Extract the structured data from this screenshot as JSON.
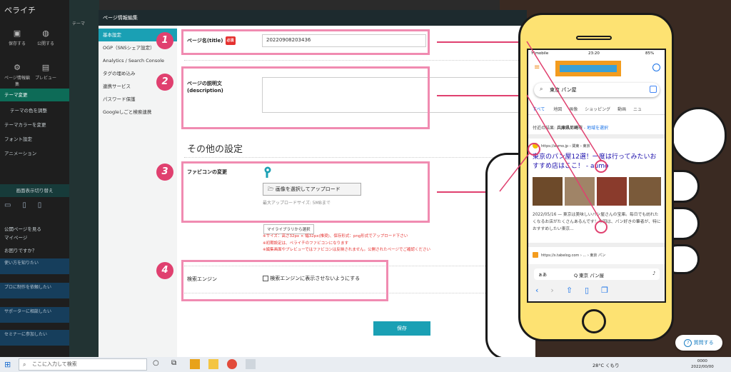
{
  "app": {
    "logo": "ペライチ",
    "toolbar": [
      {
        "label": "保存する",
        "icon": "save-icon"
      },
      {
        "label": "公開する",
        "icon": "publish-icon"
      }
    ],
    "toolbar2": [
      {
        "label": "ページ情報編集",
        "icon": "gear-icon"
      },
      {
        "label": "プレビュー",
        "icon": "preview-icon"
      }
    ],
    "menu": [
      "テーマ変更",
      "テーマの色を調整",
      "テーマカラーを変更",
      "フォント設定",
      "アニメーション"
    ],
    "device_label": "画面表示切り替え",
    "side_links": [
      "公開ページを見る",
      "マイページ",
      "お困りですか？"
    ],
    "promos": [
      "使い方を知りたい",
      "プロに制作を依頼したい",
      "サポーターに相談したい",
      "セミナーに参加したい"
    ],
    "theme_tab": "テーマ"
  },
  "modal": {
    "title": "ページ情報編集",
    "nav": [
      "基本設定",
      "OGP（SNSシェア設定）",
      "Analytics / Search Console",
      "タグの埋め込み",
      "連携サービス",
      "パスワード保護",
      "Googleしごと検索連携"
    ],
    "page_name_label": "ページ名(title)",
    "required_badge": "必須",
    "page_name_value": "20220908203436",
    "description_label": "ページの説明文\n(description)",
    "description_value": "",
    "other_heading": "その他の設定",
    "favicon_label": "ファビコンの変更",
    "upload_button": "画像を選択してアップロード",
    "upload_note": "最大アップロードサイズ: 5MBまで",
    "library_button": "マイライブラリから選択",
    "notes": [
      "※サイズ：高さ32px × 幅32px(推奨)、保存形式：png形式でアップロード下さい",
      "※初期設定は、ペライチのファビコンになります",
      "※編集画面やプレビューではファビコンは反映されません。公開されたページでご確認ください"
    ],
    "search_engine_label": "検索エンジン",
    "search_engine_checkbox": "検索エンジンに表示させないようにする",
    "save_button": "保存",
    "badges": [
      "1",
      "2",
      "3",
      "4"
    ]
  },
  "phone": {
    "carrier": "Y!mobile",
    "time": "23:20",
    "battery": "85%",
    "query": "東京 パン屋",
    "tabs": [
      "すべて",
      "地図",
      "画像",
      "ショッピング",
      "動画",
      "ニュ"
    ],
    "location_text": "付近の結果:",
    "location_place": "兵庫県尼崎市",
    "location_link": "- 地域を選択",
    "result1_url": "https://aumo.jp › 関東 › 東京",
    "result1_title": "東京のパン屋12選！一度は行ってみたいおすすめ店はここ！ - aumo",
    "result1_snippet": "2022/05/16 — 東京は美味しいパン屋さんの宝庫。毎日でも訪れたくなるお店がたくさんあるんです！今回は、パン好きの筆者が、特におすすめしたい東京...",
    "result2_url": "https://s.tabelog.com › ... › 東京 パン",
    "browser_aa": "ぁあ",
    "browser_query": "Q 東京 パン屋"
  },
  "help_button": "質問する",
  "taskbar": {
    "search_placeholder": "ここに入力して検索",
    "weather": "28°C くもり",
    "clock_time": "0000",
    "clock_date": "2022/00/00"
  },
  "colors": {
    "accent": "#1aa0b4",
    "pink": "#e0406f",
    "phone_body": "#fde272"
  }
}
